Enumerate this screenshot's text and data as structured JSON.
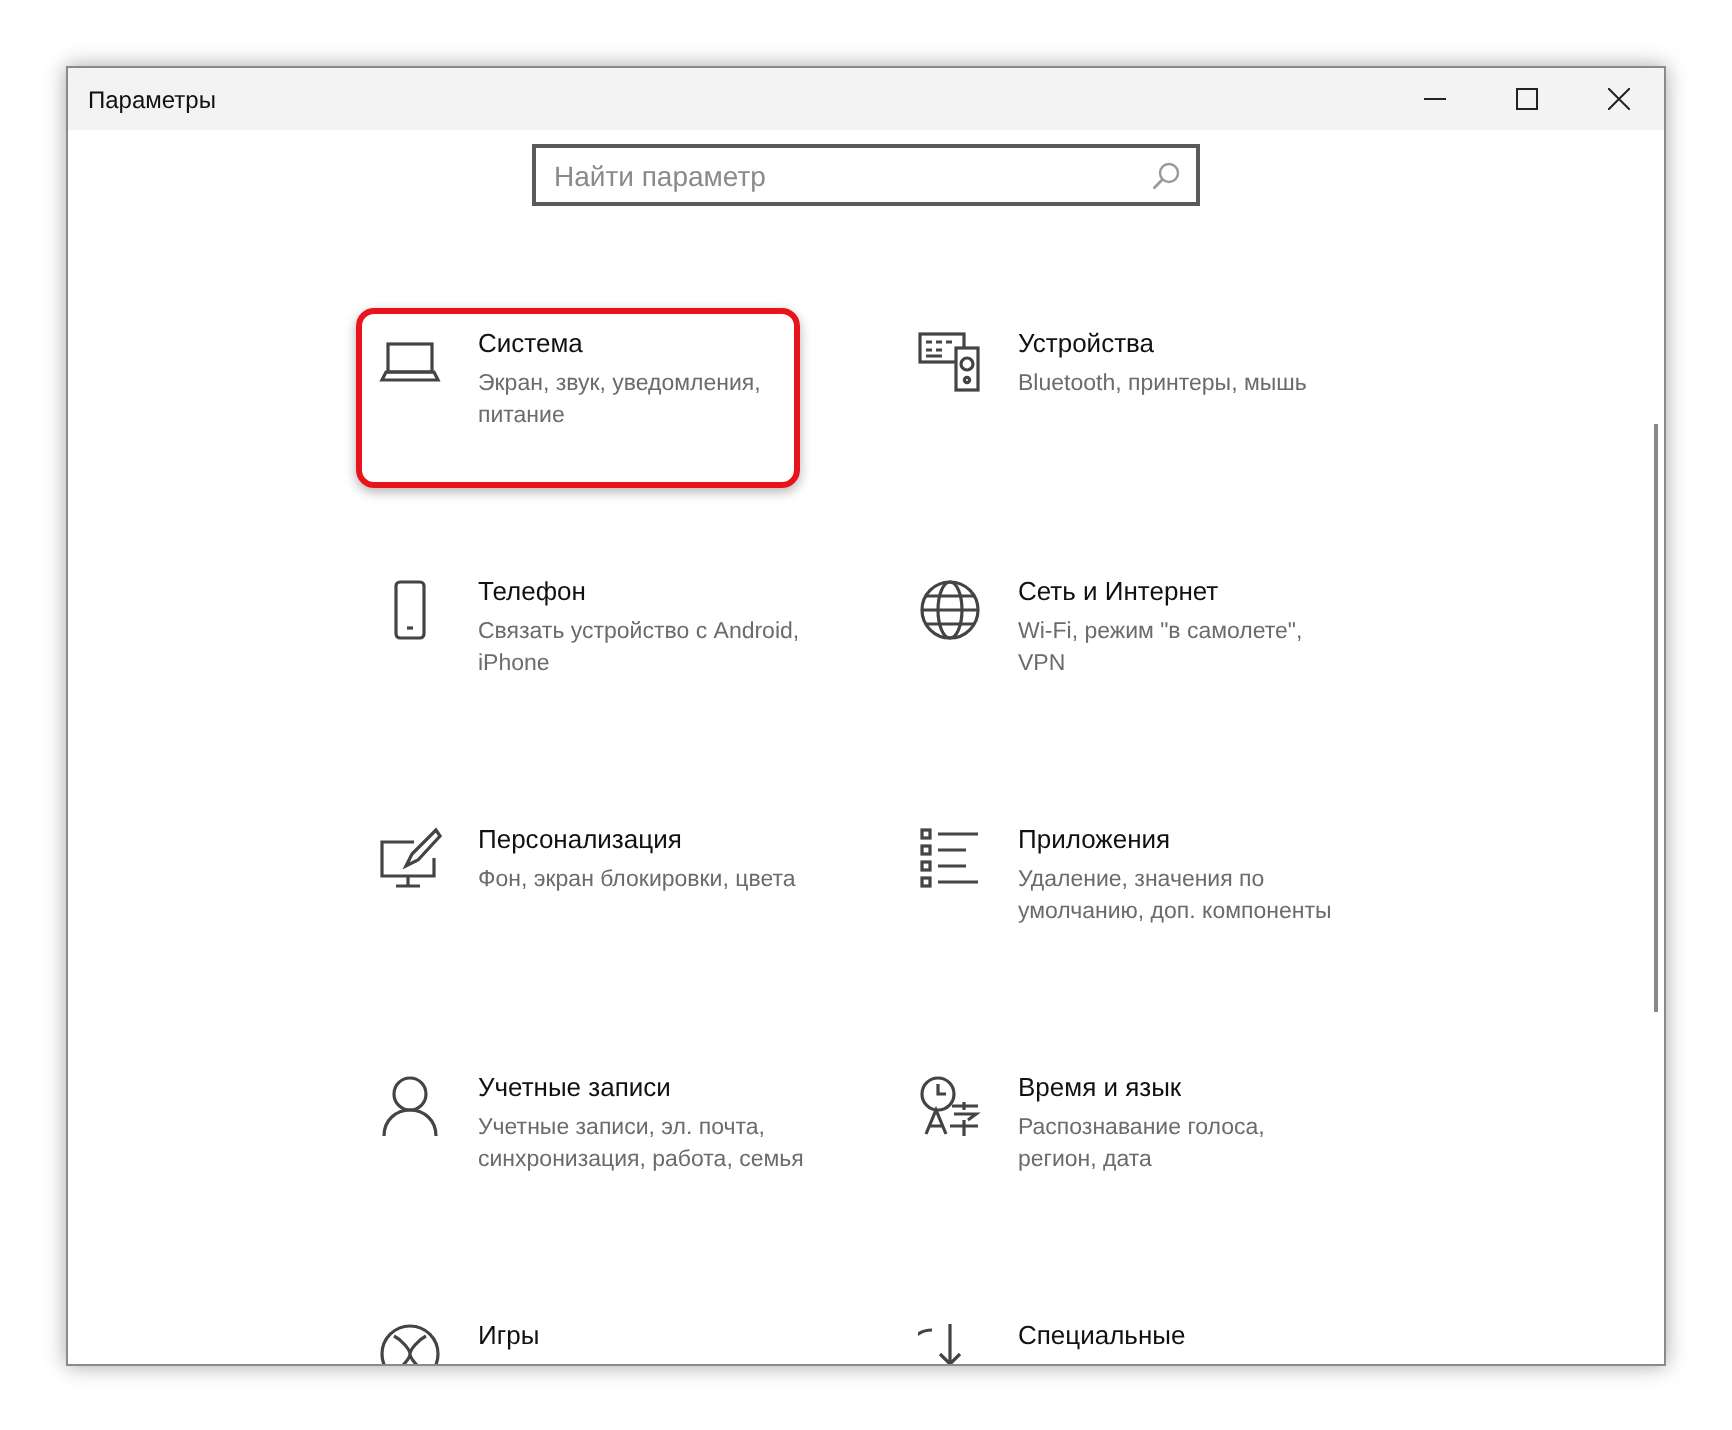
{
  "window": {
    "title": "Параметры"
  },
  "search": {
    "placeholder": "Найти параметр"
  },
  "categories": [
    {
      "title": "Система",
      "description": "Экран, звук, уведомления, питание",
      "highlighted": true
    },
    {
      "title": "Устройства",
      "description": "Bluetooth, принтеры, мышь",
      "highlighted": false
    },
    {
      "title": "Телефон",
      "description": "Связать устройство с Android, iPhone",
      "highlighted": false
    },
    {
      "title": "Сеть и Интернет",
      "description": "Wi-Fi, режим \"в самолете\", VPN",
      "highlighted": false
    },
    {
      "title": "Персонализация",
      "description": "Фон, экран блокировки, цвета",
      "highlighted": false
    },
    {
      "title": "Приложения",
      "description": "Удаление, значения по умолчанию, доп. компоненты",
      "highlighted": false
    },
    {
      "title": "Учетные записи",
      "description": "Учетные записи, эл. почта, синхронизация, работа, семья",
      "highlighted": false
    },
    {
      "title": "Время и язык",
      "description": "Распознавание голоса, регион, дата",
      "highlighted": false
    },
    {
      "title": "Игры",
      "highlighted": false
    },
    {
      "title": "Специальные",
      "highlighted": false
    }
  ]
}
